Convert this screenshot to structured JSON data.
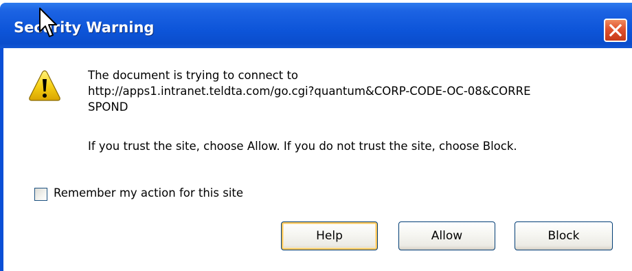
{
  "dialog": {
    "title": "Security Warning",
    "close_icon": "close-icon",
    "warning_icon": "warning-triangle-icon",
    "message_line1": "The document is trying to connect to",
    "message_url_line1": "http://apps1.intranet.teldta.com/go.cgi?quantum&CORP-CODE-OC-08&CORRE",
    "message_url_line2": "SPOND",
    "message_instruction": "If you trust the site, choose Allow. If you do not trust the site, choose Block.",
    "remember_label": "Remember my action for this site",
    "remember_checked": false,
    "buttons": {
      "help": "Help",
      "allow": "Allow",
      "block": "Block"
    }
  },
  "colors": {
    "titlebar": "#0d55d9",
    "close_button": "#e0522e",
    "warning_yellow": "#f7d117"
  }
}
